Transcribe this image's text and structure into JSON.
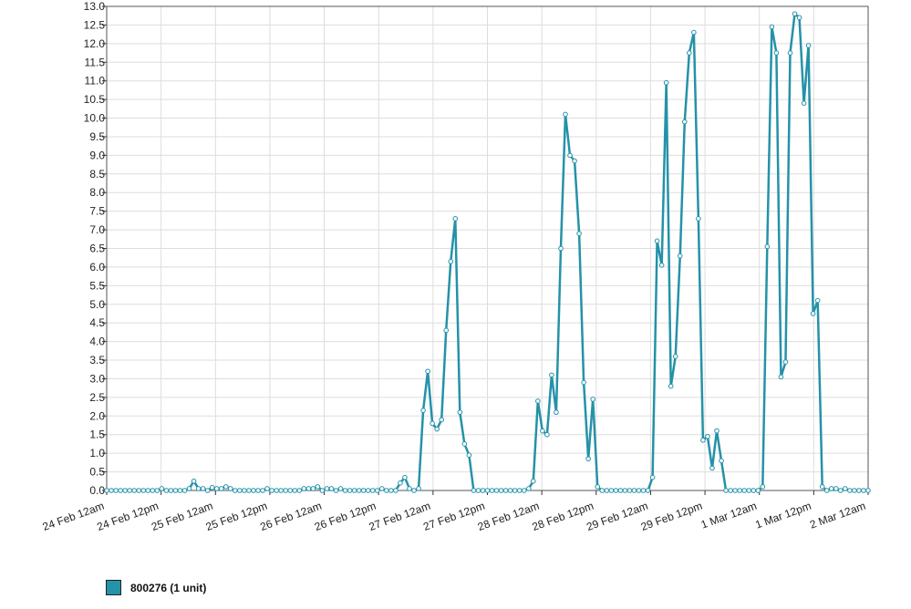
{
  "chart_data": {
    "type": "line",
    "title": "",
    "xlabel": "",
    "ylabel": "",
    "ylim": [
      0,
      13
    ],
    "y_ticks": [
      "0.0",
      "0.5",
      "1.0",
      "1.5",
      "2.0",
      "2.5",
      "3.0",
      "3.5",
      "4.0",
      "4.5",
      "5.0",
      "5.5",
      "6.0",
      "6.5",
      "7.0",
      "7.5",
      "8.0",
      "8.5",
      "9.0",
      "9.5",
      "10.0",
      "10.5",
      "11.0",
      "11.5",
      "12.0",
      "12.5",
      "13.0"
    ],
    "x_unit": "hours since 24 Feb 12am",
    "x_ticks": [
      {
        "x": 0,
        "label": "24 Feb 12am"
      },
      {
        "x": 12,
        "label": "24 Feb 12pm"
      },
      {
        "x": 24,
        "label": "25 Feb 12am"
      },
      {
        "x": 36,
        "label": "25 Feb 12pm"
      },
      {
        "x": 48,
        "label": "26 Feb 12am"
      },
      {
        "x": 60,
        "label": "26 Feb 12pm"
      },
      {
        "x": 72,
        "label": "27 Feb 12am"
      },
      {
        "x": 84,
        "label": "27 Feb 12pm"
      },
      {
        "x": 96,
        "label": "28 Feb 12am"
      },
      {
        "x": 108,
        "label": "28 Feb 12pm"
      },
      {
        "x": 120,
        "label": "29 Feb 12am"
      },
      {
        "x": 132,
        "label": "29 Feb 12pm"
      },
      {
        "x": 144,
        "label": "1 Mar 12am"
      },
      {
        "x": 156,
        "label": "1 Mar 12pm"
      },
      {
        "x": 168,
        "label": "2 Mar 12am"
      }
    ],
    "xlim": [
      0,
      168
    ],
    "grid": true,
    "legend_position": "bottom-left",
    "series": [
      {
        "name": "800276 (1 unit)",
        "color": "#2492a8",
        "values": [
          0,
          0,
          0,
          0,
          0,
          0,
          0,
          0,
          0,
          0,
          0,
          0,
          0.05,
          0,
          0,
          0,
          0,
          0,
          0.05,
          0.25,
          0.05,
          0.05,
          0,
          0.08,
          0.05,
          0.05,
          0.1,
          0.05,
          0,
          0,
          0,
          0,
          0,
          0,
          0,
          0.05,
          0,
          0,
          0,
          0,
          0,
          0,
          0,
          0.05,
          0.05,
          0.05,
          0.1,
          0,
          0.05,
          0.05,
          0,
          0.05,
          0,
          0,
          0,
          0,
          0,
          0,
          0,
          0,
          0.05,
          0,
          0,
          0,
          0.2,
          0.35,
          0.05,
          0,
          0.05,
          2.15,
          3.2,
          1.8,
          1.65,
          1.9,
          4.3,
          6.15,
          7.3,
          2.1,
          1.25,
          0.95,
          0,
          0,
          0,
          0,
          0,
          0,
          0,
          0,
          0,
          0,
          0,
          0,
          0.05,
          0.25,
          2.4,
          1.6,
          1.5,
          3.1,
          2.1,
          6.5,
          10.1,
          9.0,
          8.85,
          6.9,
          2.9,
          0.85,
          2.45,
          0.1,
          0,
          0,
          0,
          0,
          0,
          0,
          0,
          0,
          0,
          0,
          0,
          0.35,
          6.7,
          6.05,
          10.95,
          2.8,
          3.6,
          6.3,
          9.9,
          11.75,
          12.3,
          7.3,
          1.35,
          1.45,
          0.6,
          1.6,
          0.8,
          0,
          0,
          0,
          0,
          0,
          0,
          0,
          0,
          0.1,
          6.55,
          12.45,
          11.75,
          3.05,
          3.45,
          11.75,
          12.8,
          12.7,
          10.4,
          11.95,
          4.75,
          5.1,
          0.1,
          0,
          0.05,
          0.05,
          0,
          0.05,
          0,
          0,
          0,
          0,
          0
        ]
      }
    ]
  }
}
